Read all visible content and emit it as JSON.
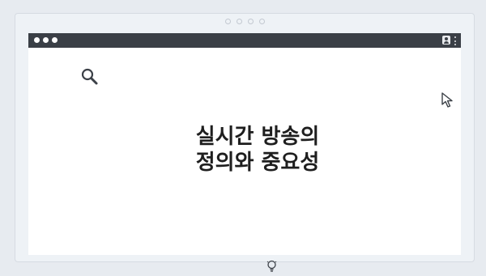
{
  "window": {
    "top_dots": [
      "dot",
      "dot",
      "dot",
      "dot"
    ],
    "window_controls": [
      "dot",
      "dot",
      "dot"
    ]
  },
  "icons": {
    "search": "search-icon",
    "cursor": "cursor-arrow-icon",
    "user": "user-icon",
    "menu": "kebab-menu-icon",
    "idea": "lightbulb-icon"
  },
  "content": {
    "title_line1": "실시간 방송의",
    "title_line2": "정의와 중요성"
  },
  "colors": {
    "background": "#e7ebf0",
    "titlebar": "#3a3f46",
    "title_text": "#1e1e1e"
  }
}
